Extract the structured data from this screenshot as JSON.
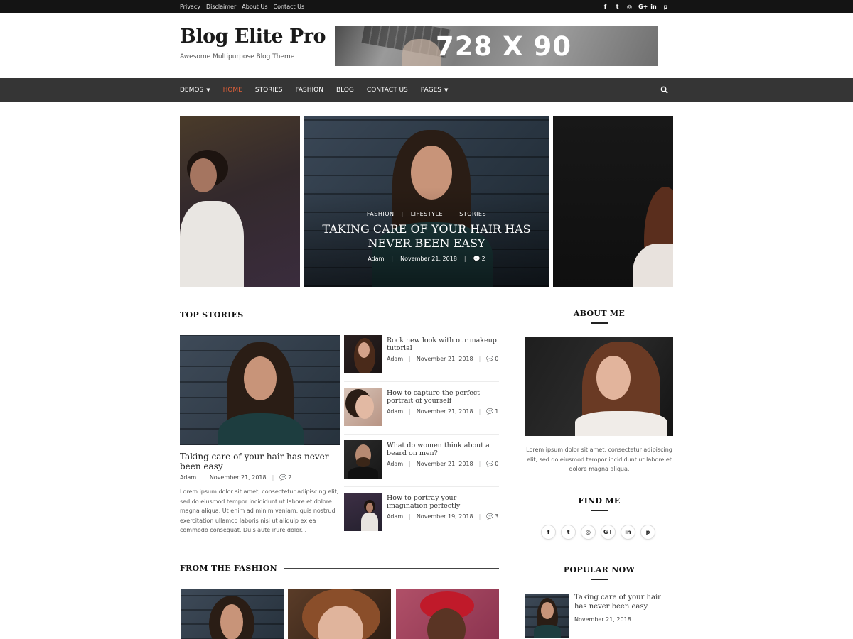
{
  "topbar": {
    "links": [
      "Privacy",
      "Disclaimer",
      "About Us",
      "Contact Us"
    ],
    "social_icons": [
      "facebook-icon",
      "twitter-icon",
      "instagram-icon",
      "google-plus-icon",
      "linkedin-icon",
      "pinterest-icon"
    ],
    "social_glyphs": [
      "f",
      "t",
      "◎",
      "G+",
      "in",
      "p"
    ]
  },
  "header": {
    "site_title": "Blog Elite Pro",
    "tagline": "Awesome Multipurpose Blog Theme",
    "banner_text": "728 X 90"
  },
  "nav": {
    "items": [
      {
        "label": "DEMOS",
        "dropdown": true
      },
      {
        "label": "HOME",
        "active": true
      },
      {
        "label": "STORIES"
      },
      {
        "label": "FASHION"
      },
      {
        "label": "BLOG"
      },
      {
        "label": "CONTACT US"
      },
      {
        "label": "PAGES",
        "dropdown": true
      }
    ],
    "search_icon": "search-icon",
    "accent_color": "#e1603a"
  },
  "slider": {
    "categories": [
      "FASHION",
      "LIFESTYLE",
      "STORIES"
    ],
    "title": "TAKING CARE OF YOUR HAIR HAS NEVER BEEN EASY",
    "author": "Adam",
    "date": "November 21, 2018",
    "comments": "2"
  },
  "top_stories": {
    "heading": "TOP STORIES",
    "featured": {
      "title": "Taking care of your hair has never been easy",
      "author": "Adam",
      "date": "November 21, 2018",
      "comments": "2",
      "excerpt": "Lorem ipsum dolor sit amet, consectetur adipiscing elit, sed do eiusmod tempor incididunt ut labore et dolore magna aliqua. Ut enim ad minim veniam, quis nostrud exercitation ullamco laboris nisi ut aliquip ex ea commodo consequat. Duis aute irure dolor..."
    },
    "items": [
      {
        "title": "Rock new look with our makeup tutorial",
        "author": "Adam",
        "date": "November 21, 2018",
        "comments": "0"
      },
      {
        "title": "How to capture the perfect portrait of yourself",
        "author": "Adam",
        "date": "November 21, 2018",
        "comments": "1"
      },
      {
        "title": "What do women think about a beard on men?",
        "author": "Adam",
        "date": "November 21, 2018",
        "comments": "0"
      },
      {
        "title": "How to portray your imagination perfectly",
        "author": "Adam",
        "date": "November 19, 2018",
        "comments": "3"
      }
    ]
  },
  "fashion": {
    "heading": "FROM THE FASHION"
  },
  "sidebar": {
    "about": {
      "heading": "ABOUT ME",
      "text": "Lorem ipsum dolor sit amet, consectetur adipiscing elit, sed do eiusmod tempor incididunt ut labore et dolore magna aliqua."
    },
    "find_me": {
      "heading": "FIND ME",
      "icons": [
        "facebook-icon",
        "twitter-icon",
        "instagram-icon",
        "google-plus-icon",
        "linkedin-icon",
        "pinterest-icon"
      ],
      "glyphs": [
        "f",
        "t",
        "◎",
        "G+",
        "in",
        "p"
      ]
    },
    "popular": {
      "heading": "POPULAR NOW",
      "title": "Taking care of your hair has never been easy",
      "date": "November 21, 2018"
    }
  }
}
